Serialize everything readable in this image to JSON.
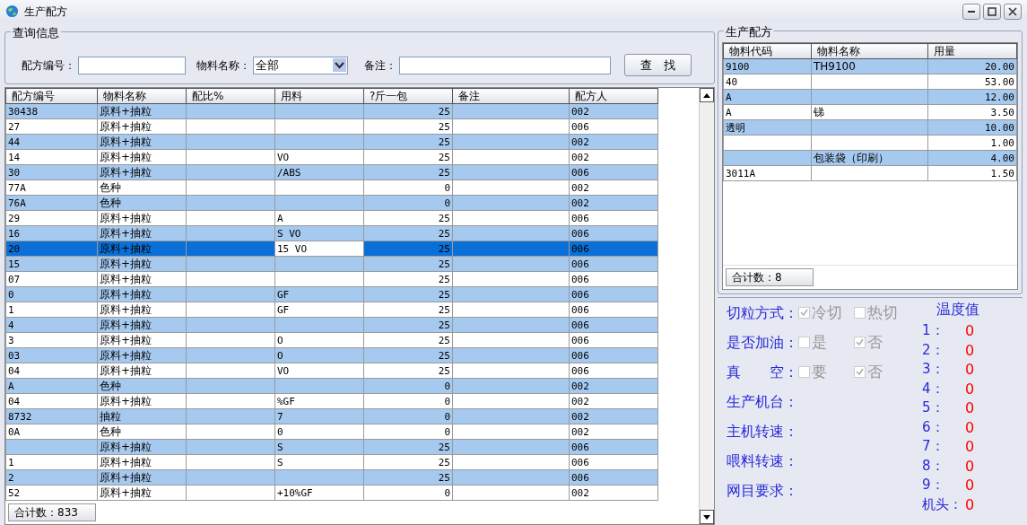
{
  "window": {
    "title": "生产配方"
  },
  "query": {
    "title": "查询信息",
    "fields": [
      {
        "label": "配方编号：",
        "kind": "input"
      },
      {
        "label": "物料名称：",
        "kind": "select",
        "value": "全部"
      },
      {
        "label": "备注：",
        "kind": "input"
      }
    ],
    "button": "查　找"
  },
  "table": {
    "columns": [
      "配方编号",
      "物料名称",
      "配比%",
      "用料",
      "?斤一包",
      "备注",
      "配方人"
    ],
    "rows": [
      {
        "cells": [
          "30438",
          "原料+抽粒",
          "",
          "",
          "25",
          "",
          "002"
        ],
        "selected": false
      },
      {
        "cells": [
          "27",
          "原料+抽粒",
          "",
          "",
          "25",
          "",
          "006"
        ],
        "selected": false
      },
      {
        "cells": [
          "44",
          "原料+抽粒",
          "",
          "",
          "25",
          "",
          "002"
        ],
        "selected": false
      },
      {
        "cells": [
          "14",
          "原料+抽粒",
          "",
          "VO",
          "25",
          "",
          "002"
        ],
        "selected": false
      },
      {
        "cells": [
          "30",
          "原料+抽粒",
          "",
          "/ABS",
          "25",
          "",
          "006"
        ],
        "selected": false
      },
      {
        "cells": [
          "77A",
          "色种",
          "",
          "",
          "0",
          "",
          "002"
        ],
        "selected": false
      },
      {
        "cells": [
          "76A",
          "色种",
          "",
          "",
          "0",
          "",
          "002"
        ],
        "selected": false
      },
      {
        "cells": [
          "29",
          "原料+抽粒",
          "",
          "A",
          "25",
          "",
          "006"
        ],
        "selected": false
      },
      {
        "cells": [
          "16",
          "原料+抽粒",
          "",
          "S VO",
          "25",
          "",
          "006"
        ],
        "selected": false
      },
      {
        "cells": [
          "20",
          "原料+抽粒",
          "",
          "15 VO",
          "25",
          "",
          "006"
        ],
        "selected": true
      },
      {
        "cells": [
          "15",
          "原料+抽粒",
          "",
          "",
          "25",
          "",
          "006"
        ],
        "selected": false
      },
      {
        "cells": [
          "07",
          "原料+抽粒",
          "",
          "",
          "25",
          "",
          "006"
        ],
        "selected": false
      },
      {
        "cells": [
          "0",
          "原料+抽粒",
          "",
          "GF",
          "25",
          "",
          "006"
        ],
        "selected": false
      },
      {
        "cells": [
          "1",
          "原料+抽粒",
          "",
          "GF",
          "25",
          "",
          "006"
        ],
        "selected": false
      },
      {
        "cells": [
          "4",
          "原料+抽粒",
          "",
          "",
          "25",
          "",
          "006"
        ],
        "selected": false
      },
      {
        "cells": [
          "3",
          "原料+抽粒",
          "",
          "O",
          "25",
          "",
          "006"
        ],
        "selected": false
      },
      {
        "cells": [
          "03",
          "原料+抽粒",
          "",
          "O",
          "25",
          "",
          "006"
        ],
        "selected": false
      },
      {
        "cells": [
          "04",
          "原料+抽粒",
          "",
          "VO",
          "25",
          "",
          "006"
        ],
        "selected": false
      },
      {
        "cells": [
          "A",
          "色种",
          "",
          "",
          "0",
          "",
          "002"
        ],
        "selected": false
      },
      {
        "cells": [
          "04",
          "原料+抽粒",
          "",
          "%GF",
          "0",
          "",
          "002"
        ],
        "selected": false
      },
      {
        "cells": [
          "8732",
          "抽粒",
          "",
          "7",
          "0",
          "",
          "002"
        ],
        "selected": false
      },
      {
        "cells": [
          "0A",
          "色种",
          "",
          "0",
          "0",
          "",
          "002"
        ],
        "selected": false
      },
      {
        "cells": [
          "",
          "原料+抽粒",
          "",
          "S",
          "25",
          "",
          "006"
        ],
        "selected": false
      },
      {
        "cells": [
          "1",
          "原料+抽粒",
          "",
          "S",
          "25",
          "",
          "006"
        ],
        "selected": false
      },
      {
        "cells": [
          "2",
          "原料+抽粒",
          "",
          "",
          "25",
          "",
          "006"
        ],
        "selected": false
      },
      {
        "cells": [
          "52",
          "原料+抽粒",
          "",
          "+10%GF",
          "0",
          "",
          "002"
        ],
        "selected": false
      }
    ],
    "total": "合计数：833"
  },
  "recipe": {
    "title": "生产配方",
    "columns": [
      "物料代码",
      "物料名称",
      "用量"
    ],
    "rows": [
      {
        "cells": [
          "9100",
          "TH9100",
          "20.00"
        ]
      },
      {
        "cells": [
          "40",
          "",
          "53.00"
        ]
      },
      {
        "cells": [
          "A",
          "",
          "12.00"
        ]
      },
      {
        "cells": [
          "A",
          "锑",
          "3.50"
        ]
      },
      {
        "cells": [
          "透明",
          "",
          "10.00"
        ]
      },
      {
        "cells": [
          "",
          "",
          "1.00"
        ]
      },
      {
        "cells": [
          "",
          "包装袋（印刷）",
          "4.00"
        ]
      },
      {
        "cells": [
          "3011A",
          "",
          "1.50"
        ]
      }
    ],
    "total": "合计数：8"
  },
  "settings": {
    "options": [
      {
        "label": "切粒方式：",
        "choices": [
          {
            "label": "冷切",
            "checked": true,
            "disabled": true
          },
          {
            "label": "热切",
            "checked": false,
            "disabled": true
          }
        ]
      },
      {
        "label": "是否加油：",
        "choices": [
          {
            "label": "是",
            "checked": false,
            "disabled": true
          },
          {
            "label": "否",
            "checked": true,
            "disabled": true
          }
        ]
      },
      {
        "label": "真　　空：",
        "choices": [
          {
            "label": "要",
            "checked": false,
            "disabled": true
          },
          {
            "label": "否",
            "checked": true,
            "disabled": true
          }
        ]
      }
    ],
    "params": [
      "生产机台：",
      "主机转速：",
      "喂料转速：",
      "网目要求："
    ],
    "temps": {
      "title": "温度值",
      "items": [
        {
          "label": "1：",
          "value": "0"
        },
        {
          "label": "2：",
          "value": "0"
        },
        {
          "label": "3：",
          "value": "0"
        },
        {
          "label": "4：",
          "value": "0"
        },
        {
          "label": "5：",
          "value": "0"
        },
        {
          "label": "6：",
          "value": "0"
        },
        {
          "label": "7：",
          "value": "0"
        },
        {
          "label": "8：",
          "value": "0"
        },
        {
          "label": "9：",
          "value": "0"
        },
        {
          "label": "机头：",
          "value": "0"
        }
      ]
    }
  }
}
